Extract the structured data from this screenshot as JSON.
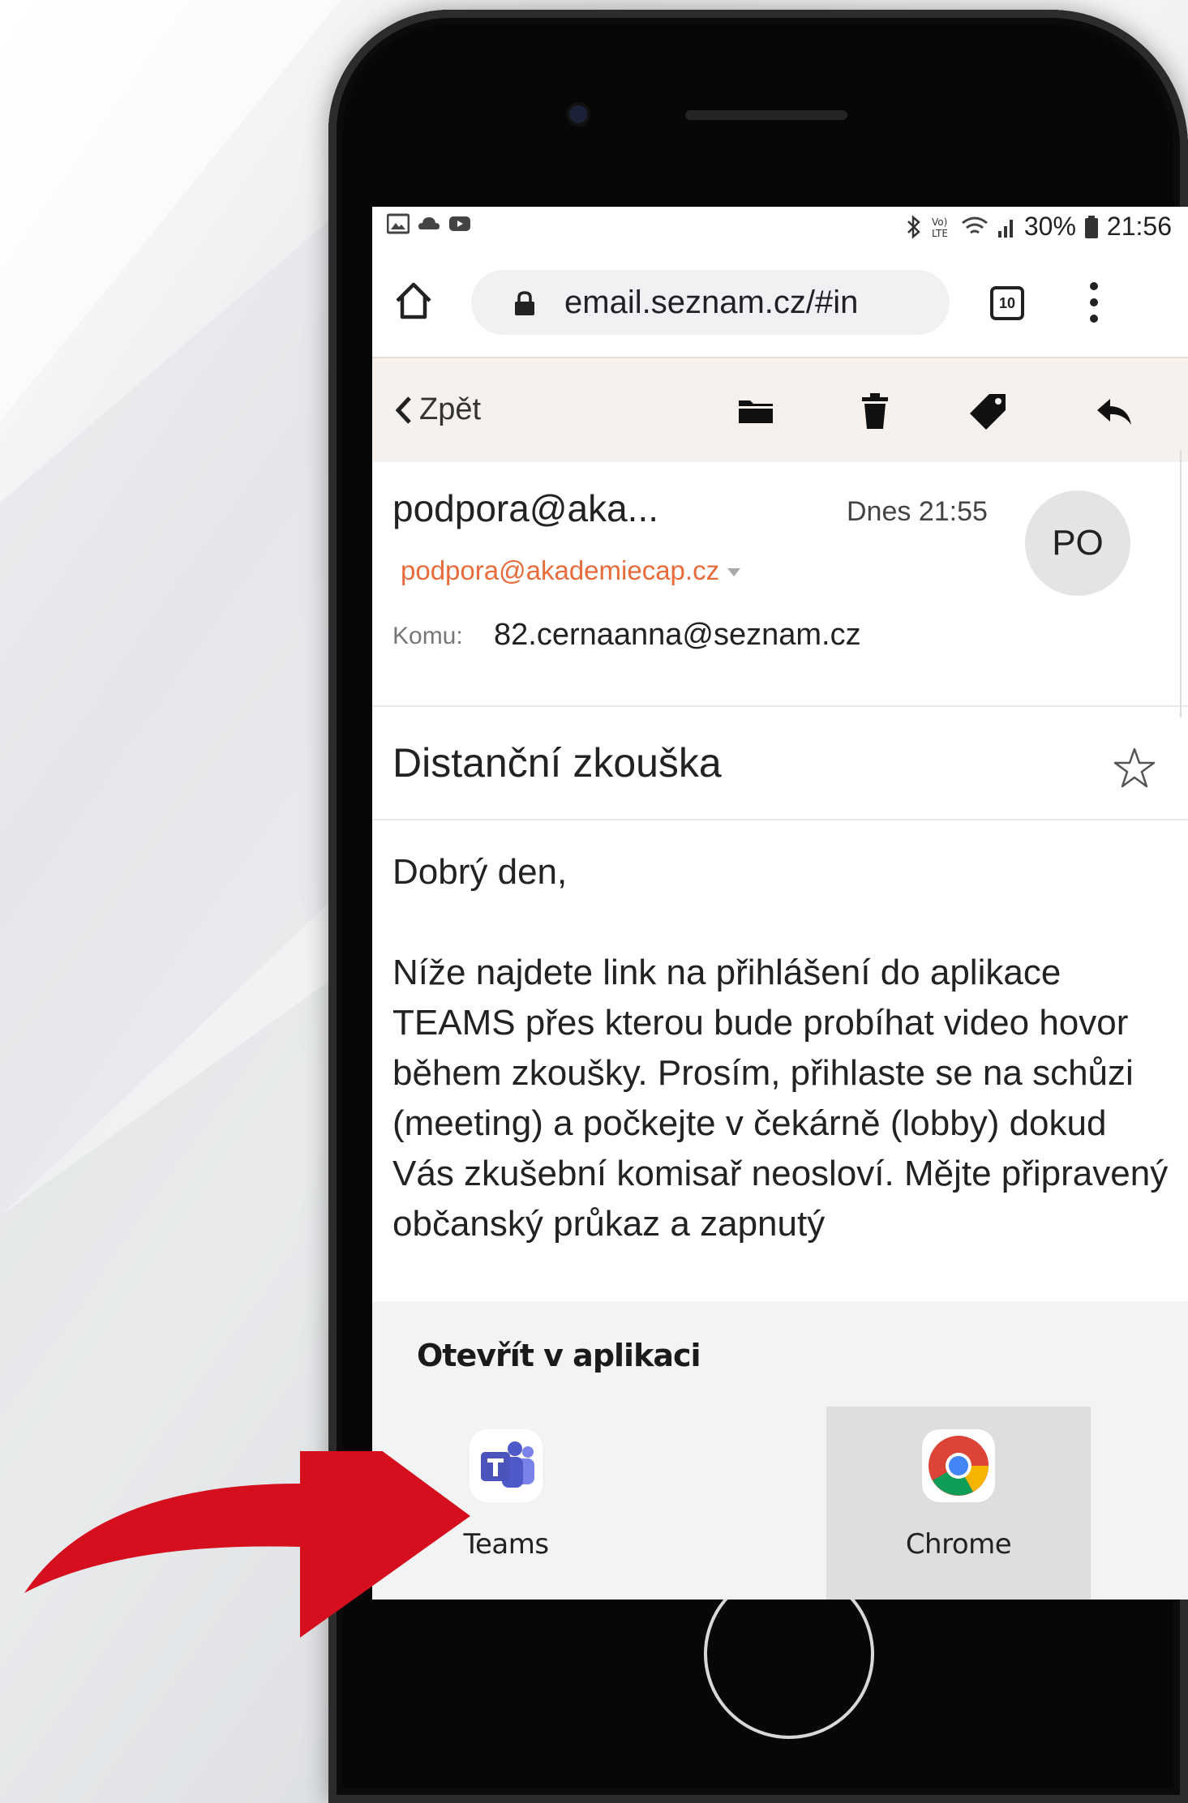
{
  "status_bar": {
    "battery": "30%",
    "time": "21:56",
    "left_icons": [
      "image-icon",
      "cloud-icon",
      "youtube-icon"
    ],
    "right_icons": [
      "bluetooth-icon",
      "volte-icon",
      "wifi-icon",
      "signal-icon",
      "battery-icon"
    ]
  },
  "browser": {
    "url": "email.seznam.cz/#in",
    "tab_count": "10"
  },
  "toolbar": {
    "back_label": "Zpět",
    "icons": [
      "folder-icon",
      "trash-icon",
      "tag-icon",
      "reply-icon"
    ]
  },
  "message": {
    "sender_name": "podpora@aka...",
    "date": "Dnes 21:55",
    "avatar_initials": "PO",
    "sender_email": "podpora@akademiecap.cz",
    "to_label": "Komu:",
    "to_value": "82.cernaanna@seznam.cz",
    "subject": "Distanční zkouška",
    "greeting": "Dobrý den,",
    "body": "Níže najdete link na přihlášení do aplikace TEAMS přes kterou bude probíhat video hovor během zkoušky. Prosím, přihlaste se na schůzi (meeting) a počkejte v čekárně (lobby) dokud Vás zkušební komisař neosloví. Mějte připravený občanský průkaz a zapnutý"
  },
  "open_in_app": {
    "title": "Otevřít v aplikaci",
    "apps": [
      {
        "label": "Teams",
        "icon": "teams-icon"
      },
      {
        "label": "Chrome",
        "icon": "chrome-icon"
      }
    ]
  },
  "colors": {
    "accent_email": "#e86b3c",
    "toolbar_bg": "#f6f1ec",
    "arrow": "#d50f1e",
    "teams": "#5059c9"
  }
}
